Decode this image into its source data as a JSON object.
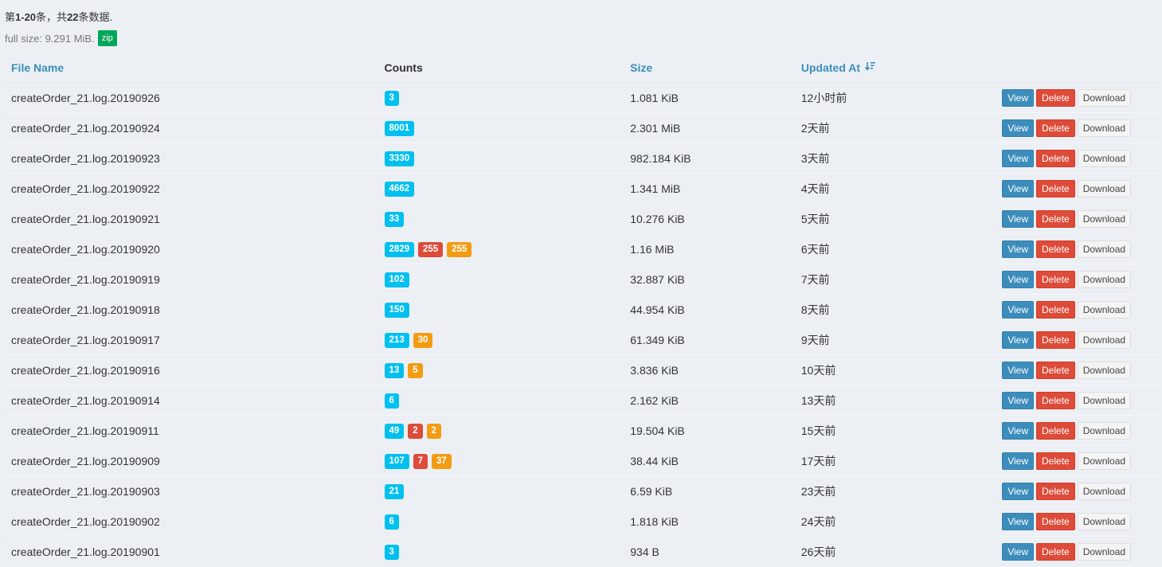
{
  "summary": {
    "prefix": "第",
    "range": "1-20",
    "middle": "条，共",
    "total": "22",
    "suffix": "条数据."
  },
  "fullsize": {
    "label": "full size: 9.291 MiB.",
    "zip_label": "zip"
  },
  "table": {
    "headers": {
      "file_name": "File Name",
      "counts": "Counts",
      "size": "Size",
      "updated_at": "Updated At"
    },
    "buttons": {
      "view": "View",
      "delete": "Delete",
      "download": "Download"
    },
    "rows": [
      {
        "name": "createOrder_21.log.20190926",
        "counts": [
          {
            "v": "3",
            "t": "info"
          }
        ],
        "size": "1.081 KiB",
        "updated": "12小时前"
      },
      {
        "name": "createOrder_21.log.20190924",
        "counts": [
          {
            "v": "8001",
            "t": "info"
          }
        ],
        "size": "2.301 MiB",
        "updated": "2天前"
      },
      {
        "name": "createOrder_21.log.20190923",
        "counts": [
          {
            "v": "3330",
            "t": "info"
          }
        ],
        "size": "982.184 KiB",
        "updated": "3天前"
      },
      {
        "name": "createOrder_21.log.20190922",
        "counts": [
          {
            "v": "4662",
            "t": "info"
          }
        ],
        "size": "1.341 MiB",
        "updated": "4天前"
      },
      {
        "name": "createOrder_21.log.20190921",
        "counts": [
          {
            "v": "33",
            "t": "info"
          }
        ],
        "size": "10.276 KiB",
        "updated": "5天前"
      },
      {
        "name": "createOrder_21.log.20190920",
        "counts": [
          {
            "v": "2829",
            "t": "info"
          },
          {
            "v": "255",
            "t": "danger"
          },
          {
            "v": "255",
            "t": "warning"
          }
        ],
        "size": "1.16 MiB",
        "updated": "6天前"
      },
      {
        "name": "createOrder_21.log.20190919",
        "counts": [
          {
            "v": "102",
            "t": "info"
          }
        ],
        "size": "32.887 KiB",
        "updated": "7天前"
      },
      {
        "name": "createOrder_21.log.20190918",
        "counts": [
          {
            "v": "150",
            "t": "info"
          }
        ],
        "size": "44.954 KiB",
        "updated": "8天前"
      },
      {
        "name": "createOrder_21.log.20190917",
        "counts": [
          {
            "v": "213",
            "t": "info"
          },
          {
            "v": "30",
            "t": "warning"
          }
        ],
        "size": "61.349 KiB",
        "updated": "9天前"
      },
      {
        "name": "createOrder_21.log.20190916",
        "counts": [
          {
            "v": "13",
            "t": "info"
          },
          {
            "v": "5",
            "t": "warning"
          }
        ],
        "size": "3.836 KiB",
        "updated": "10天前"
      },
      {
        "name": "createOrder_21.log.20190914",
        "counts": [
          {
            "v": "6",
            "t": "info"
          }
        ],
        "size": "2.162 KiB",
        "updated": "13天前"
      },
      {
        "name": "createOrder_21.log.20190911",
        "counts": [
          {
            "v": "49",
            "t": "info"
          },
          {
            "v": "2",
            "t": "danger"
          },
          {
            "v": "2",
            "t": "warning"
          }
        ],
        "size": "19.504 KiB",
        "updated": "15天前"
      },
      {
        "name": "createOrder_21.log.20190909",
        "counts": [
          {
            "v": "107",
            "t": "info"
          },
          {
            "v": "7",
            "t": "danger"
          },
          {
            "v": "37",
            "t": "warning"
          }
        ],
        "size": "38.44 KiB",
        "updated": "17天前"
      },
      {
        "name": "createOrder_21.log.20190903",
        "counts": [
          {
            "v": "21",
            "t": "info"
          }
        ],
        "size": "6.59 KiB",
        "updated": "23天前"
      },
      {
        "name": "createOrder_21.log.20190902",
        "counts": [
          {
            "v": "6",
            "t": "info"
          }
        ],
        "size": "1.818 KiB",
        "updated": "24天前"
      },
      {
        "name": "createOrder_21.log.20190901",
        "counts": [
          {
            "v": "3",
            "t": "info"
          }
        ],
        "size": "934 B",
        "updated": "26天前"
      }
    ]
  },
  "colors": {
    "info": "#00c0ef",
    "danger": "#dd4b39",
    "warning": "#f39c12",
    "primary": "#3c8dbc",
    "success": "#00a65a"
  }
}
